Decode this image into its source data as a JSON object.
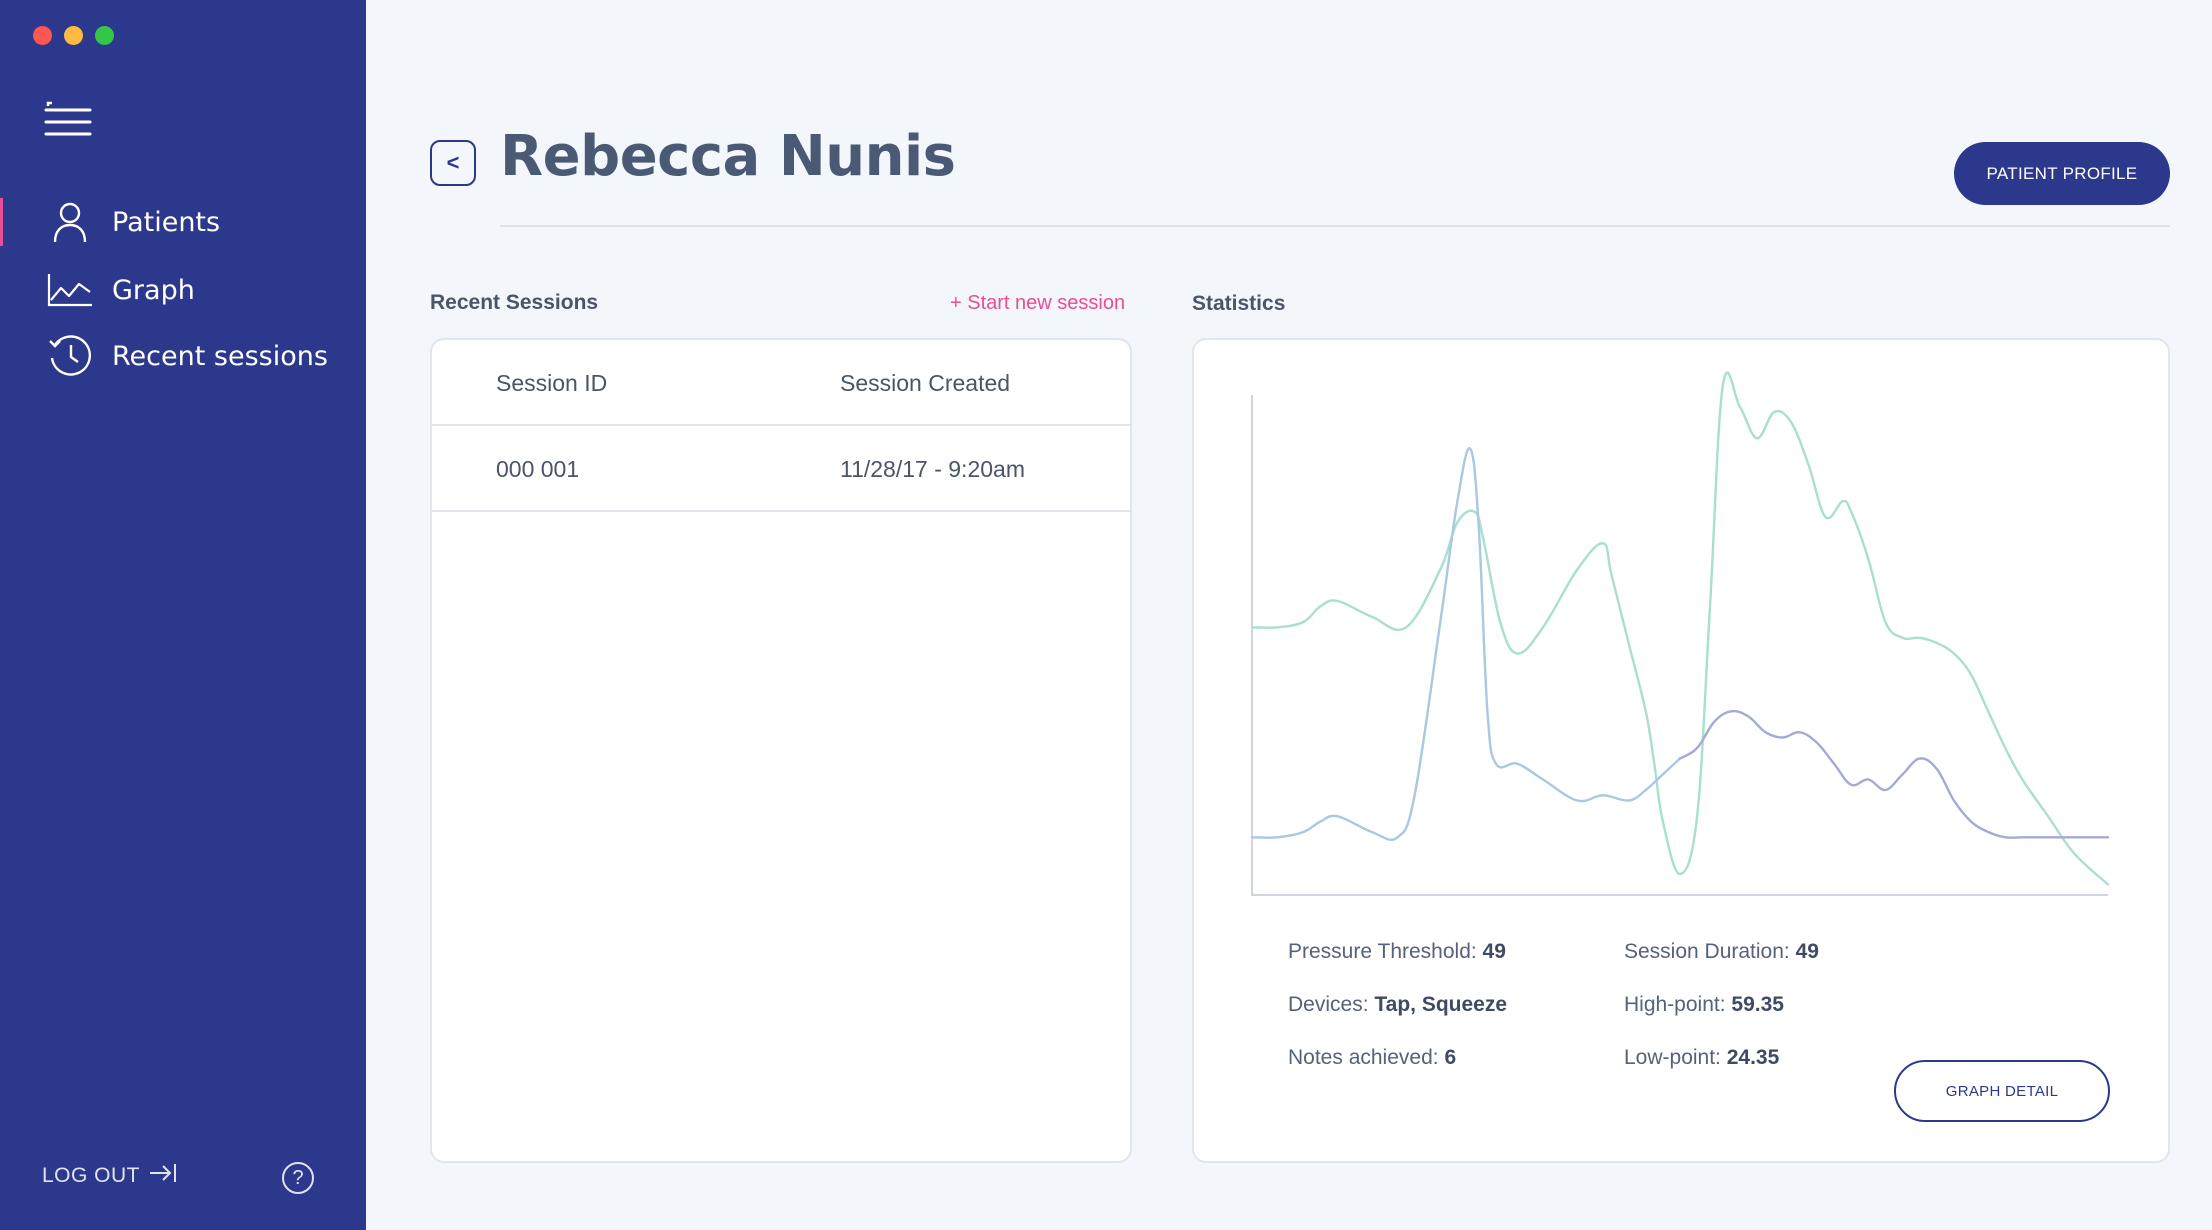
{
  "window": {
    "controls": [
      "close",
      "minimize",
      "zoom"
    ]
  },
  "sidebar": {
    "menu_icon": "hamburger-menu-icon",
    "items": [
      {
        "label": "Patients",
        "icon": "user-icon",
        "active": true
      },
      {
        "label": "Graph",
        "icon": "line-chart-icon",
        "active": false
      },
      {
        "label": "Recent sessions",
        "icon": "history-clock-icon",
        "active": false
      }
    ],
    "logout_label": "LOG OUT",
    "logout_icon": "logout-arrow-icon",
    "help_icon": "question-circle-icon",
    "help_glyph": "?"
  },
  "header": {
    "back_glyph": "<",
    "title": "Rebecca Nunis",
    "profile_button": "PATIENT PROFILE"
  },
  "recent_sessions": {
    "title": "Recent Sessions",
    "start_link": "+ Start new session",
    "columns": [
      "Session ID",
      "Session Created"
    ],
    "rows": [
      {
        "id": "000 001",
        "created": "11/28/17 - 9:20am"
      }
    ]
  },
  "statistics": {
    "title": "Statistics",
    "items": {
      "pressure_threshold": {
        "label": "Pressure Threshold:",
        "value": "49"
      },
      "devices": {
        "label": "Devices:",
        "value": "Tap, Squeeze"
      },
      "notes_achieved": {
        "label": "Notes achieved:",
        "value": "6"
      },
      "session_duration": {
        "label": "Session Duration:",
        "value": "49"
      },
      "high_point": {
        "label": "High-point:",
        "value": "59.35"
      },
      "low_point": {
        "label": "Low-point:",
        "value": "24.35"
      }
    },
    "graph_detail_button": "GRAPH DETAIL"
  },
  "colors": {
    "sidebar_bg": "#2c388c",
    "accent_pink": "#e94e95",
    "line_green": "#a8dfcf",
    "line_blue": "#a9c8e2",
    "line_purple": "#a4aad6"
  },
  "chart_data": {
    "type": "line",
    "title": "",
    "xlabel": "",
    "ylabel": "",
    "grid": false,
    "legend": "none",
    "xlim": [
      0,
      100
    ],
    "ylim": [
      0,
      100
    ],
    "series": [
      {
        "color": "#a8dfcf",
        "x": [
          0,
          3,
          6,
          8,
          10,
          14,
          18,
          22,
          24,
          26,
          27,
          29,
          31,
          34,
          38,
          41,
          42,
          44,
          46,
          47,
          48,
          50,
          52,
          53.5,
          55,
          57,
          59,
          61,
          63,
          65,
          67,
          69,
          70,
          72,
          74,
          76,
          78,
          80,
          82,
          84,
          86,
          88,
          90,
          93,
          96,
          100
        ],
        "y": [
          51,
          51,
          52,
          55,
          56,
          53,
          51,
          62,
          71,
          73,
          68,
          52,
          46,
          51,
          62,
          67,
          61,
          48,
          35,
          25,
          14,
          4,
          15,
          55,
          97,
          93,
          87,
          92,
          90,
          82,
          72,
          75,
          73,
          64,
          52,
          49,
          49,
          48,
          46,
          42,
          35,
          28,
          22,
          15,
          8,
          2
        ]
      },
      {
        "color": "#a9c8e2",
        "x": [
          0,
          3,
          6,
          8,
          10,
          14,
          17,
          19,
          22,
          24,
          25.5,
          26.5,
          27.5,
          28.5,
          31,
          34,
          38,
          41,
          44,
          46,
          48,
          50
        ],
        "y": [
          11,
          11,
          12,
          14,
          15,
          12,
          11,
          19,
          52,
          75,
          85,
          70,
          35,
          25,
          25,
          22,
          18,
          19,
          18,
          20,
          23,
          26
        ]
      },
      {
        "color": "#a4aad6",
        "x": [
          50,
          52,
          54,
          56,
          58,
          60,
          62,
          64,
          66,
          68,
          70,
          72,
          74,
          76,
          78,
          80,
          82,
          84,
          86,
          88,
          90,
          93,
          96,
          100
        ],
        "y": [
          26,
          28,
          33,
          35,
          34,
          31,
          30,
          31,
          29,
          25,
          21,
          22,
          20,
          23,
          26,
          24,
          18,
          14,
          12,
          11,
          11,
          11,
          11,
          11
        ]
      }
    ]
  }
}
